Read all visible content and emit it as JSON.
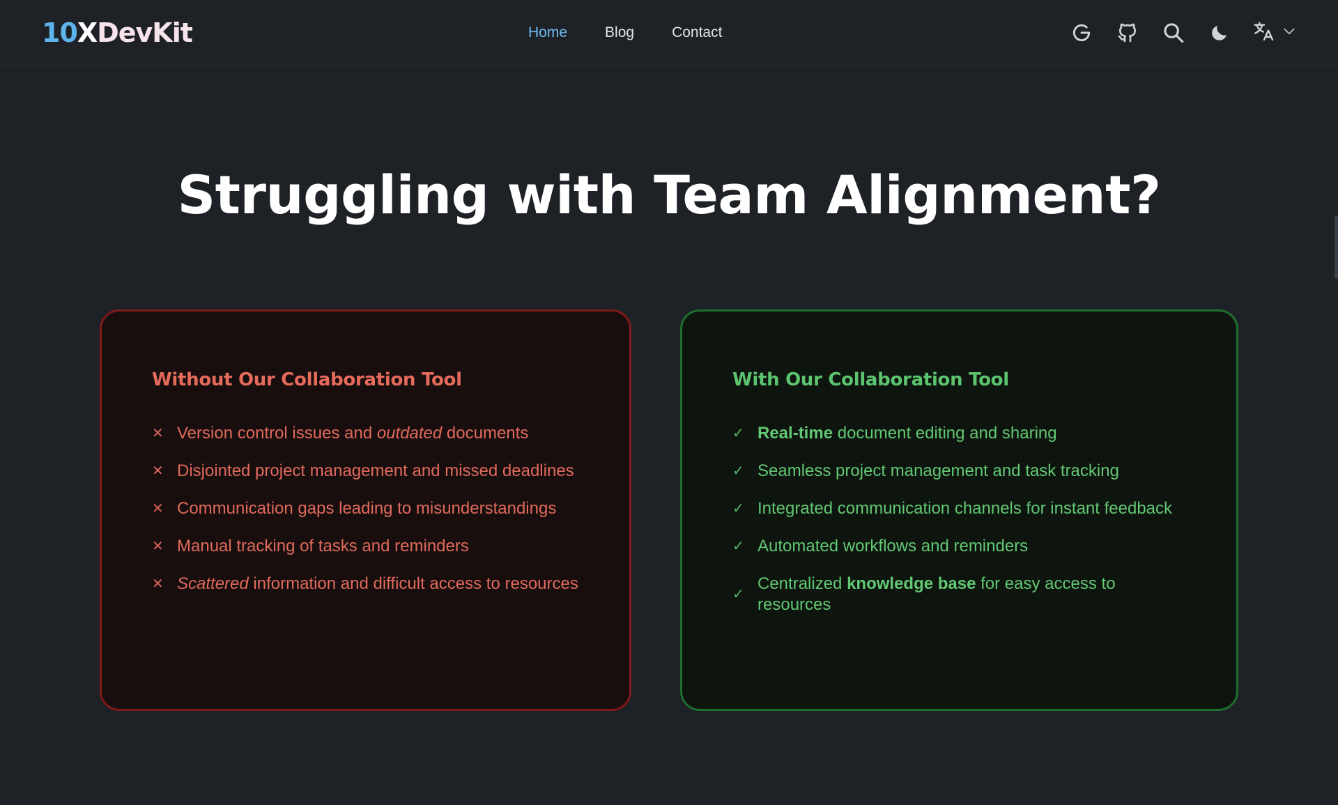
{
  "header": {
    "logo": {
      "num": "10",
      "x": "X",
      "brand": "DevKit"
    },
    "nav": [
      {
        "label": "Home",
        "active": true
      },
      {
        "label": "Blog",
        "active": false
      },
      {
        "label": "Contact",
        "active": false
      }
    ],
    "icons": [
      "google-icon",
      "github-icon",
      "search-icon",
      "moon-icon",
      "translate-icon",
      "chevron-down-icon"
    ]
  },
  "hero": {
    "title": "Struggling with Team Alignment?"
  },
  "without": {
    "heading": "Without Our Collaboration Tool",
    "items": [
      {
        "pre": "Version control issues and ",
        "em": "outdated",
        "post": " documents"
      },
      {
        "text": "Disjointed project management and missed deadlines"
      },
      {
        "text": "Communication gaps leading to misunderstandings"
      },
      {
        "text": "Manual tracking of tasks and reminders"
      },
      {
        "em": "Scattered",
        "post": " information and difficult access to resources"
      }
    ]
  },
  "with": {
    "heading": "With Our Collaboration Tool",
    "items": [
      {
        "strong": "Real-time",
        "post": " document editing and sharing"
      },
      {
        "text": "Seamless project management and task tracking"
      },
      {
        "text": "Integrated communication channels for instant feedback"
      },
      {
        "text": "Automated workflows and reminders"
      },
      {
        "pre": "Centralized ",
        "strong": "knowledge base",
        "post": " for easy access to resources"
      }
    ]
  },
  "colors": {
    "background": "#1e2227",
    "accent": "#6cbcf0",
    "bad": "#e06a5c",
    "good": "#62c873"
  }
}
